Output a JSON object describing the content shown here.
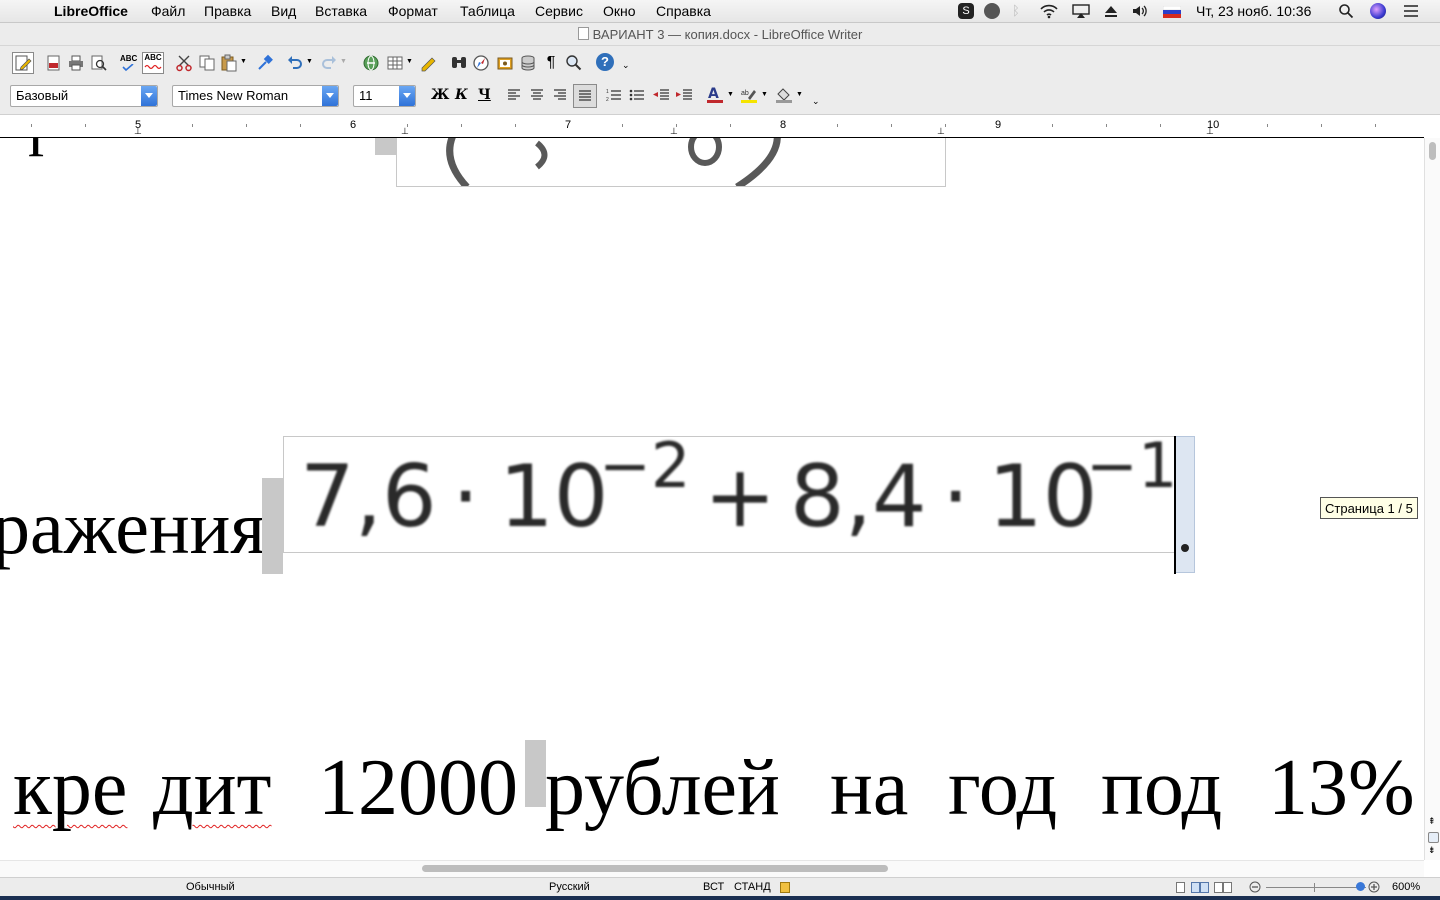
{
  "menubar": {
    "app_name": "LibreOffice",
    "items": [
      "Файл",
      "Правка",
      "Вид",
      "Вставка",
      "Формат",
      "Таблица",
      "Сервис",
      "Окно",
      "Справка"
    ],
    "datetime": "Чт, 23 нояб.  10:36"
  },
  "window": {
    "title": "ВАРИАНТ 3 — копия.docx - LibreOffice Writer"
  },
  "toolbar2": {
    "style": "Базовый",
    "font": "Times New Roman",
    "size": "11",
    "bold": "Ж",
    "italic": "К",
    "underline": "Ч"
  },
  "ruler": {
    "labels": [
      "5",
      "6",
      "7",
      "8",
      "9",
      "10"
    ]
  },
  "document": {
    "fragment_top": "г",
    "word_left": "ражения",
    "formula": {
      "a": "7,6",
      "dot": "·",
      "base": "10",
      "exp1": "−2",
      "plus": "+",
      "b": "8,4",
      "exp2": "−1"
    },
    "line_bottom": [
      "кре",
      "дит",
      "12000",
      "рублей",
      "на",
      "год",
      "под",
      "13%"
    ]
  },
  "tooltip": "Страница 1 / 5",
  "status": {
    "page_style": "Обычный",
    "language": "Русский",
    "insert_mode": "ВСТ",
    "selection_mode": "СТАНД",
    "zoom": "600%"
  },
  "colors": {
    "accent": "#2f72d8",
    "selection": "#c8c8c8",
    "spell": "#e02020"
  }
}
